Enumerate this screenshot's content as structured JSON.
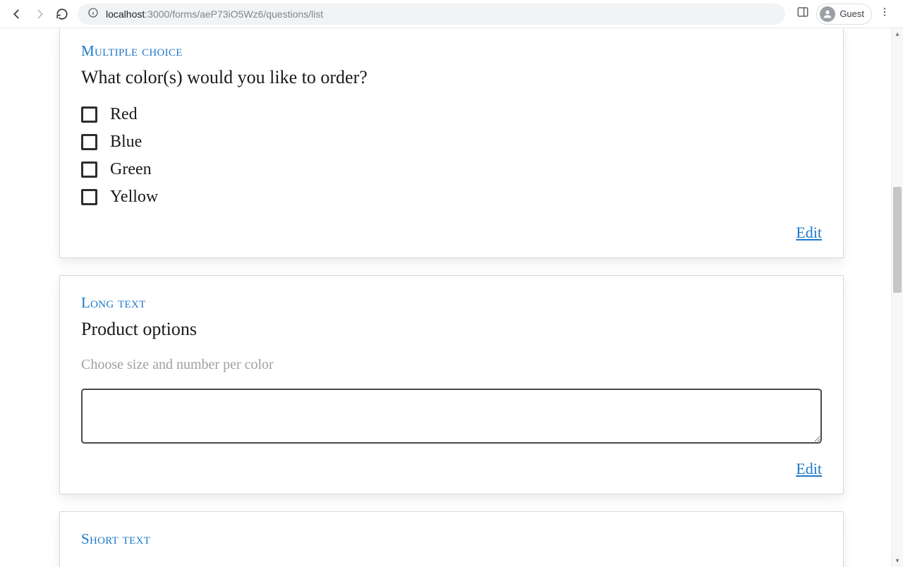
{
  "browser": {
    "url_host": "localhost",
    "url_port_path": ":3000/forms/aeP73iO5Wz6/questions/list",
    "profile_label": "Guest"
  },
  "cards": {
    "multiple_choice": {
      "type_label": "Multiple choice",
      "question": "What color(s) would you like to order?",
      "options": [
        "Red",
        "Blue",
        "Green",
        "Yellow"
      ],
      "edit_label": "Edit"
    },
    "long_text": {
      "type_label": "Long text",
      "question": "Product options",
      "help": "Choose size and number per color",
      "value": "",
      "edit_label": "Edit"
    },
    "short_text": {
      "type_label": "Short text"
    }
  }
}
